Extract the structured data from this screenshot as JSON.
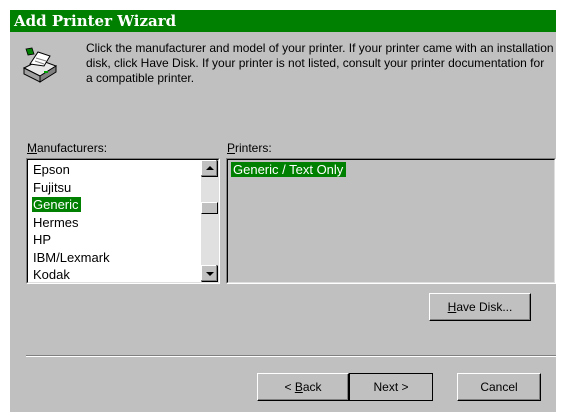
{
  "window": {
    "title": "Add Printer Wizard",
    "icon": "printer-icon",
    "accent_color": "#008000"
  },
  "intro": {
    "text": "Click the manufacturer and model of your printer. If your printer came with an installation disk, click Have Disk. If your printer is not listed, consult your printer documentation for a compatible printer."
  },
  "manufacturers": {
    "label_first": "M",
    "label_rest": "anufacturers:",
    "items": [
      "Epson",
      "Fujitsu",
      "Generic",
      "Hermes",
      "HP",
      "IBM/Lexmark",
      "Kodak"
    ],
    "selected": "Generic"
  },
  "printers": {
    "label_first": "P",
    "label_rest": "rinters:",
    "items": [
      "Generic / Text Only"
    ],
    "selected": "Generic / Text Only"
  },
  "buttons": {
    "have_disk_first": "H",
    "have_disk_rest": "ave Disk...",
    "back_prefix": "< ",
    "back_first": "B",
    "back_rest": "ack",
    "next": "Next >",
    "cancel": "Cancel"
  }
}
